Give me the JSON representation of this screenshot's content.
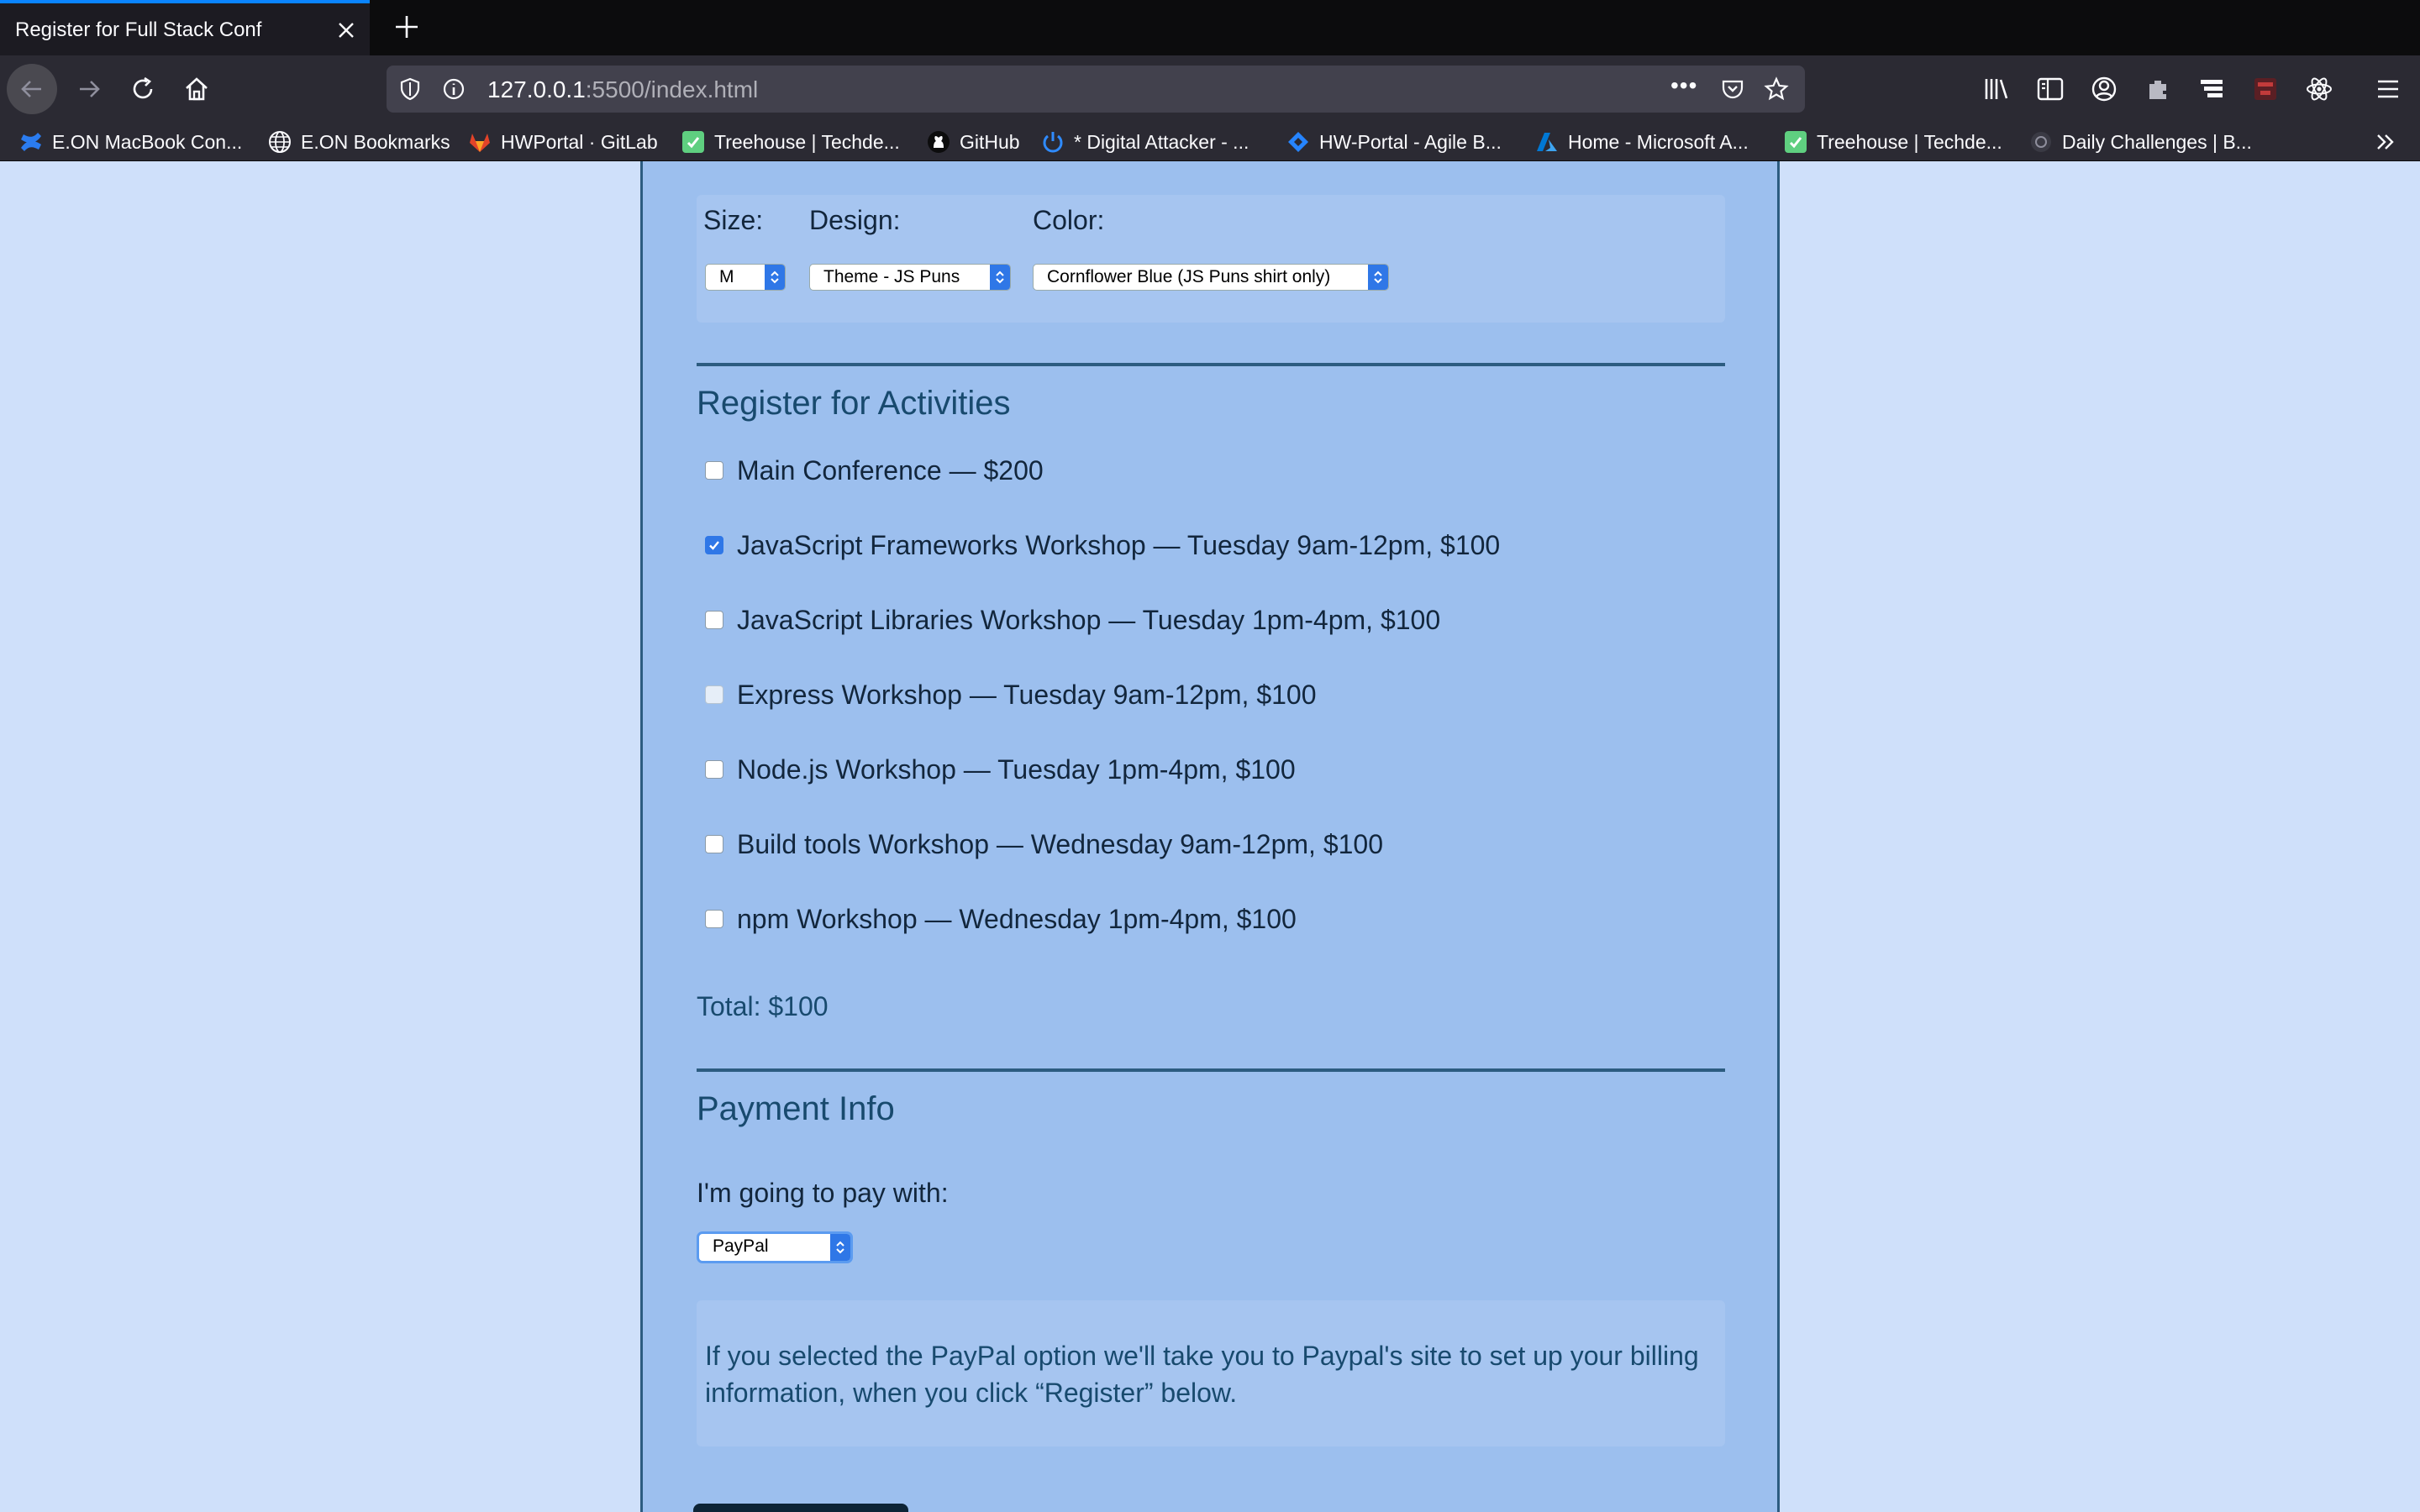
{
  "browser": {
    "tab_title": "Register for Full Stack Conf",
    "url_host": "127.0.0.1",
    "url_rest": ":5500/index.html",
    "url_menu": "•••",
    "bookmarks": [
      {
        "label": "E.ON MacBook Con...",
        "icon": "confluence-icon"
      },
      {
        "label": "E.ON Bookmarks",
        "icon": "globe-icon"
      },
      {
        "label": "HWPortal · GitLab",
        "icon": "gitlab-icon"
      },
      {
        "label": "Treehouse | Techde...",
        "icon": "treehouse-icon"
      },
      {
        "label": "GitHub",
        "icon": "github-icon"
      },
      {
        "label": "* Digital Attacker - ...",
        "icon": "power-icon"
      },
      {
        "label": "HW-Portal - Agile B...",
        "icon": "jira-icon"
      },
      {
        "label": "Home - Microsoft A...",
        "icon": "azure-icon"
      },
      {
        "label": "Treehouse | Techde...",
        "icon": "treehouse-icon"
      },
      {
        "label": "Daily Challenges | B...",
        "icon": "challenge-icon"
      }
    ]
  },
  "shirt": {
    "size_label": "Size:",
    "design_label": "Design:",
    "color_label": "Color:",
    "size_value": "M",
    "design_value": "Theme - JS Puns",
    "color_value": "Cornflower Blue (JS Puns shirt only)"
  },
  "activities": {
    "title": "Register for Activities",
    "items": [
      {
        "label": "Main Conference — $200",
        "checked": false,
        "disabled": false
      },
      {
        "label": "JavaScript Frameworks Workshop — Tuesday 9am-12pm, $100",
        "checked": true,
        "disabled": false
      },
      {
        "label": "JavaScript Libraries Workshop — Tuesday 1pm-4pm, $100",
        "checked": false,
        "disabled": false
      },
      {
        "label": "Express Workshop — Tuesday 9am-12pm, $100",
        "checked": false,
        "disabled": true
      },
      {
        "label": "Node.js Workshop — Tuesday 1pm-4pm, $100",
        "checked": false,
        "disabled": false
      },
      {
        "label": "Build tools Workshop — Wednesday 9am-12pm, $100",
        "checked": false,
        "disabled": false
      },
      {
        "label": "npm Workshop — Wednesday 1pm-4pm, $100",
        "checked": false,
        "disabled": false
      }
    ],
    "total": "Total: $100"
  },
  "payment": {
    "title": "Payment Info",
    "pay_label": "I'm going to pay with:",
    "method": "PayPal",
    "info": "If you selected the PayPal option we'll take you to Paypal's site to set up your billing information, when you click “Register” below."
  },
  "colors": {
    "page_bg": "#cfe0fa",
    "form_bg": "#9cbfee",
    "accent": "#2c5c80",
    "heading": "#184a6e",
    "select_accent": "#2f77e7"
  }
}
